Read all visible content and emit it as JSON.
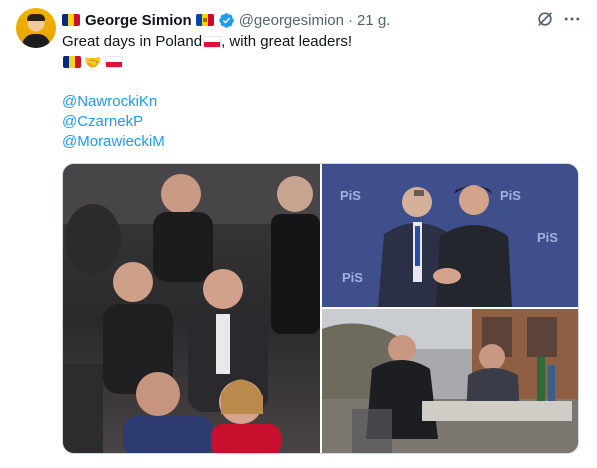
{
  "author": {
    "name": "George Simion",
    "handle": "@georgesimion",
    "separator": "·",
    "time": "21 g."
  },
  "icons": {
    "avatar": "profile-photo",
    "name_flag_left": "romania-flag",
    "name_flag_right": "moldova-flag",
    "verified": "verified-badge-icon",
    "grok": "grok-icon",
    "more": "more-icon",
    "handshake": "handshake-emoji"
  },
  "tweet": {
    "line1": "Great days in Poland",
    "line1_tail": ", with great leaders!",
    "handshake": "🤝",
    "mentions": [
      "@NawrockiKn",
      "@CzarnekP",
      "@MorawieckiM"
    ]
  },
  "media": {
    "photos": [
      {
        "name": "stadium-crowd-photo"
      },
      {
        "name": "pis-backdrop-handshake-photo",
        "backdrop_text": "PiS"
      },
      {
        "name": "outdoor-cafe-photo"
      }
    ]
  },
  "colors": {
    "link": "#1d9bf0",
    "verified": "#1d9bf0",
    "secondary_text": "#536471",
    "text": "#0f1419",
    "border": "#cfd9de"
  }
}
